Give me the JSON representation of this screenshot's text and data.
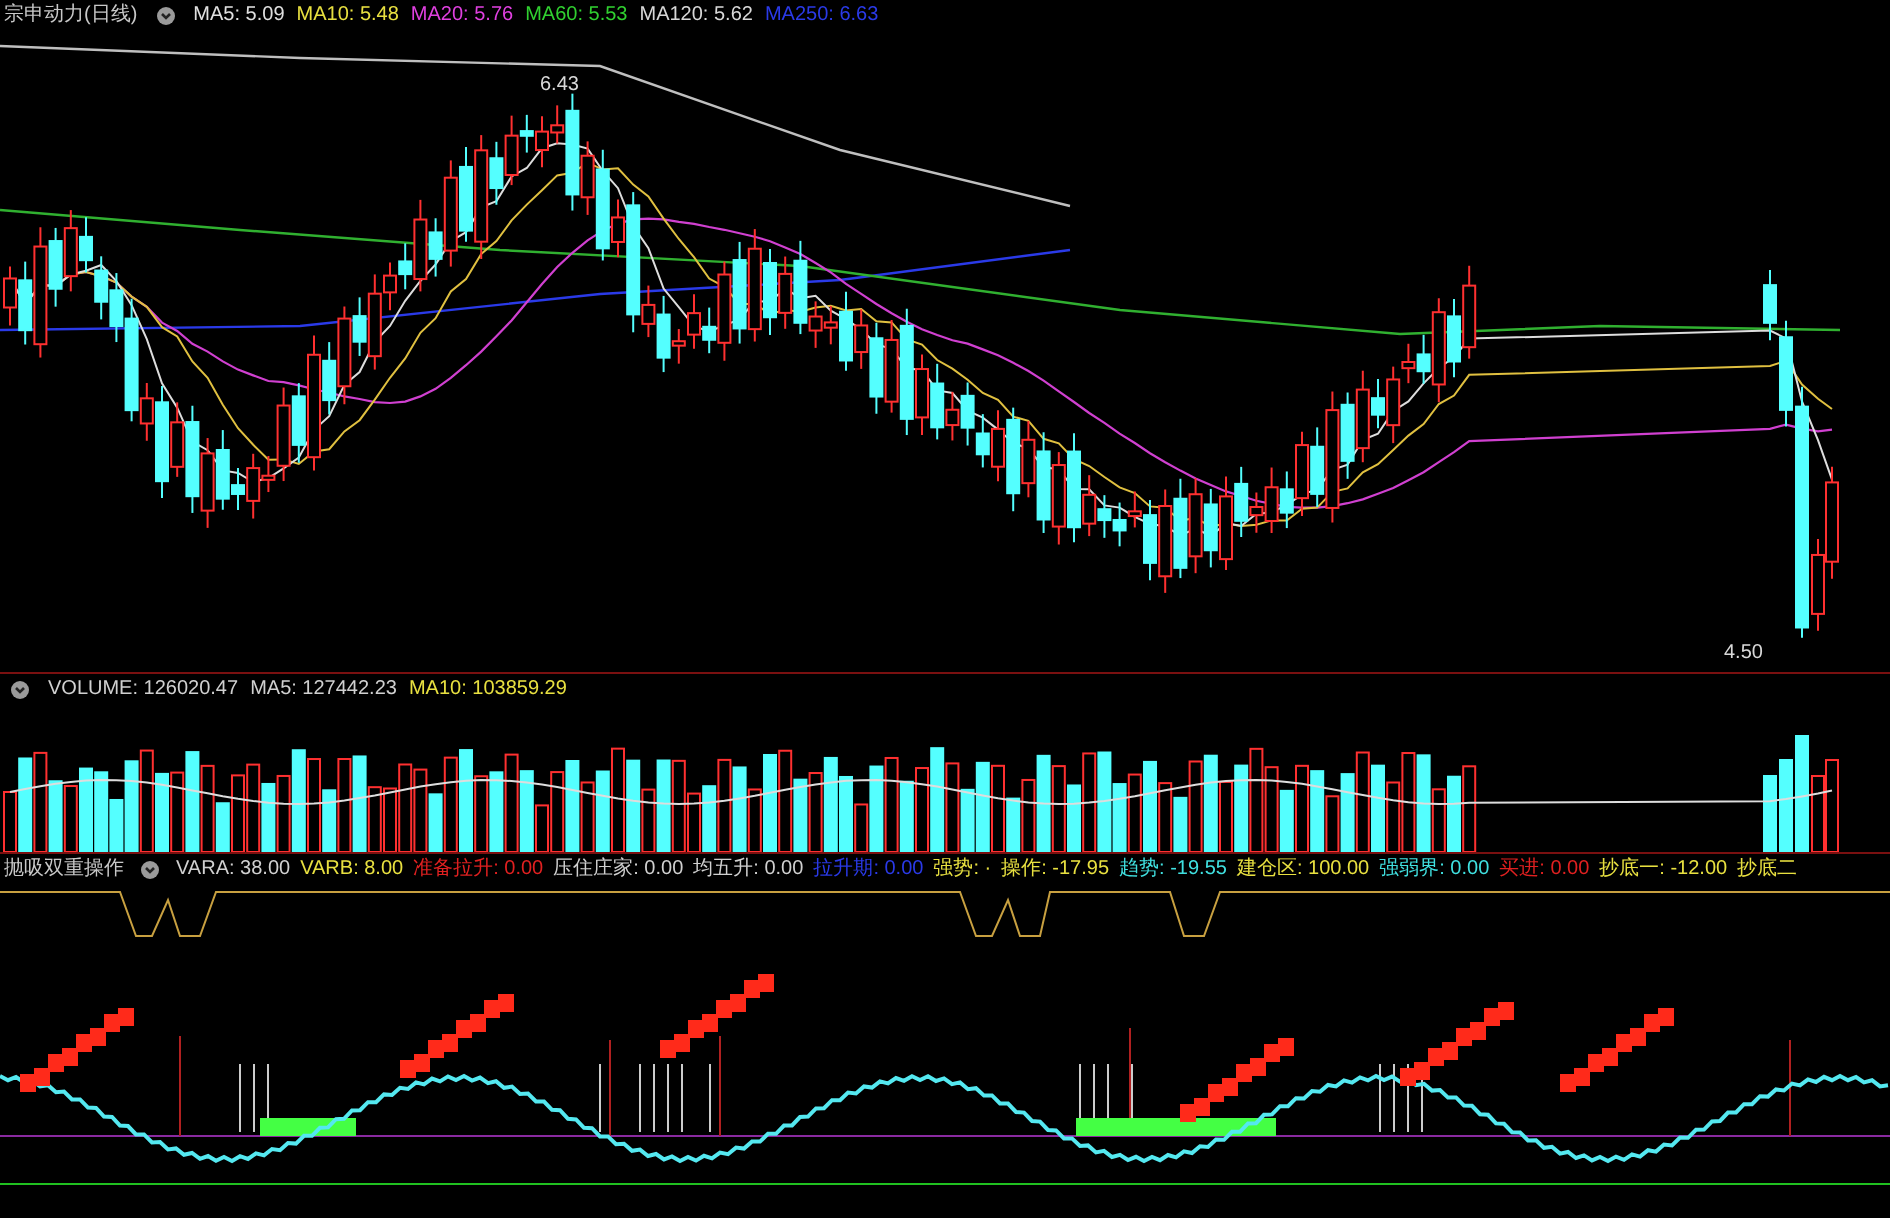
{
  "price_panel": {
    "title": "宗申动力(日线)",
    "indicators": [
      {
        "label": "MA5: 5.09",
        "color": "#e0e0e0"
      },
      {
        "label": "MA10: 5.48",
        "color": "#e8e040"
      },
      {
        "label": "MA20: 5.76",
        "color": "#e040e0"
      },
      {
        "label": "MA60: 5.53",
        "color": "#30d030"
      },
      {
        "label": "MA120: 5.62",
        "color": "#d8d8d8"
      },
      {
        "label": "MA250: 6.63",
        "color": "#2a3ae8"
      }
    ],
    "labels": [
      {
        "text": "6.43"
      },
      {
        "text": "4.50"
      }
    ]
  },
  "volume_panel": {
    "indicators": [
      {
        "label": "VOLUME: 126020.47",
        "color": "#d0d0d0"
      },
      {
        "label": "MA5: 127442.23",
        "color": "#d0d0d0"
      },
      {
        "label": "MA10: 103859.29",
        "color": "#e8e040"
      }
    ]
  },
  "indicator_panel": {
    "title": "抛吸双重操作",
    "indicators": [
      {
        "label": "VARA: 38.00",
        "color": "#d0d0d0"
      },
      {
        "label": "VARB: 8.00",
        "color": "#e8e040"
      },
      {
        "label": "准备拉升: 0.00",
        "color": "#e02020"
      },
      {
        "label": "压住庄家: 0.00",
        "color": "#d0d0d0"
      },
      {
        "label": "均五升: 0.00",
        "color": "#d0d0d0"
      },
      {
        "label": "拉升期: 0.00",
        "color": "#2a3ae8"
      },
      {
        "label": "强势: ·",
        "color": "#e8e040"
      },
      {
        "label": "操作: -17.95",
        "color": "#e8e040"
      },
      {
        "label": "趋势: -19.55",
        "color": "#40e0e0"
      },
      {
        "label": "建仓区: 100.00",
        "color": "#e8e040"
      },
      {
        "label": "强弱界: 0.00",
        "color": "#40e0e0"
      },
      {
        "label": "买进: 0.00",
        "color": "#e02020"
      },
      {
        "label": "抄底一: -12.00",
        "color": "#e8e040"
      },
      {
        "label": "抄底二",
        "color": "#e8e040"
      }
    ]
  }
}
